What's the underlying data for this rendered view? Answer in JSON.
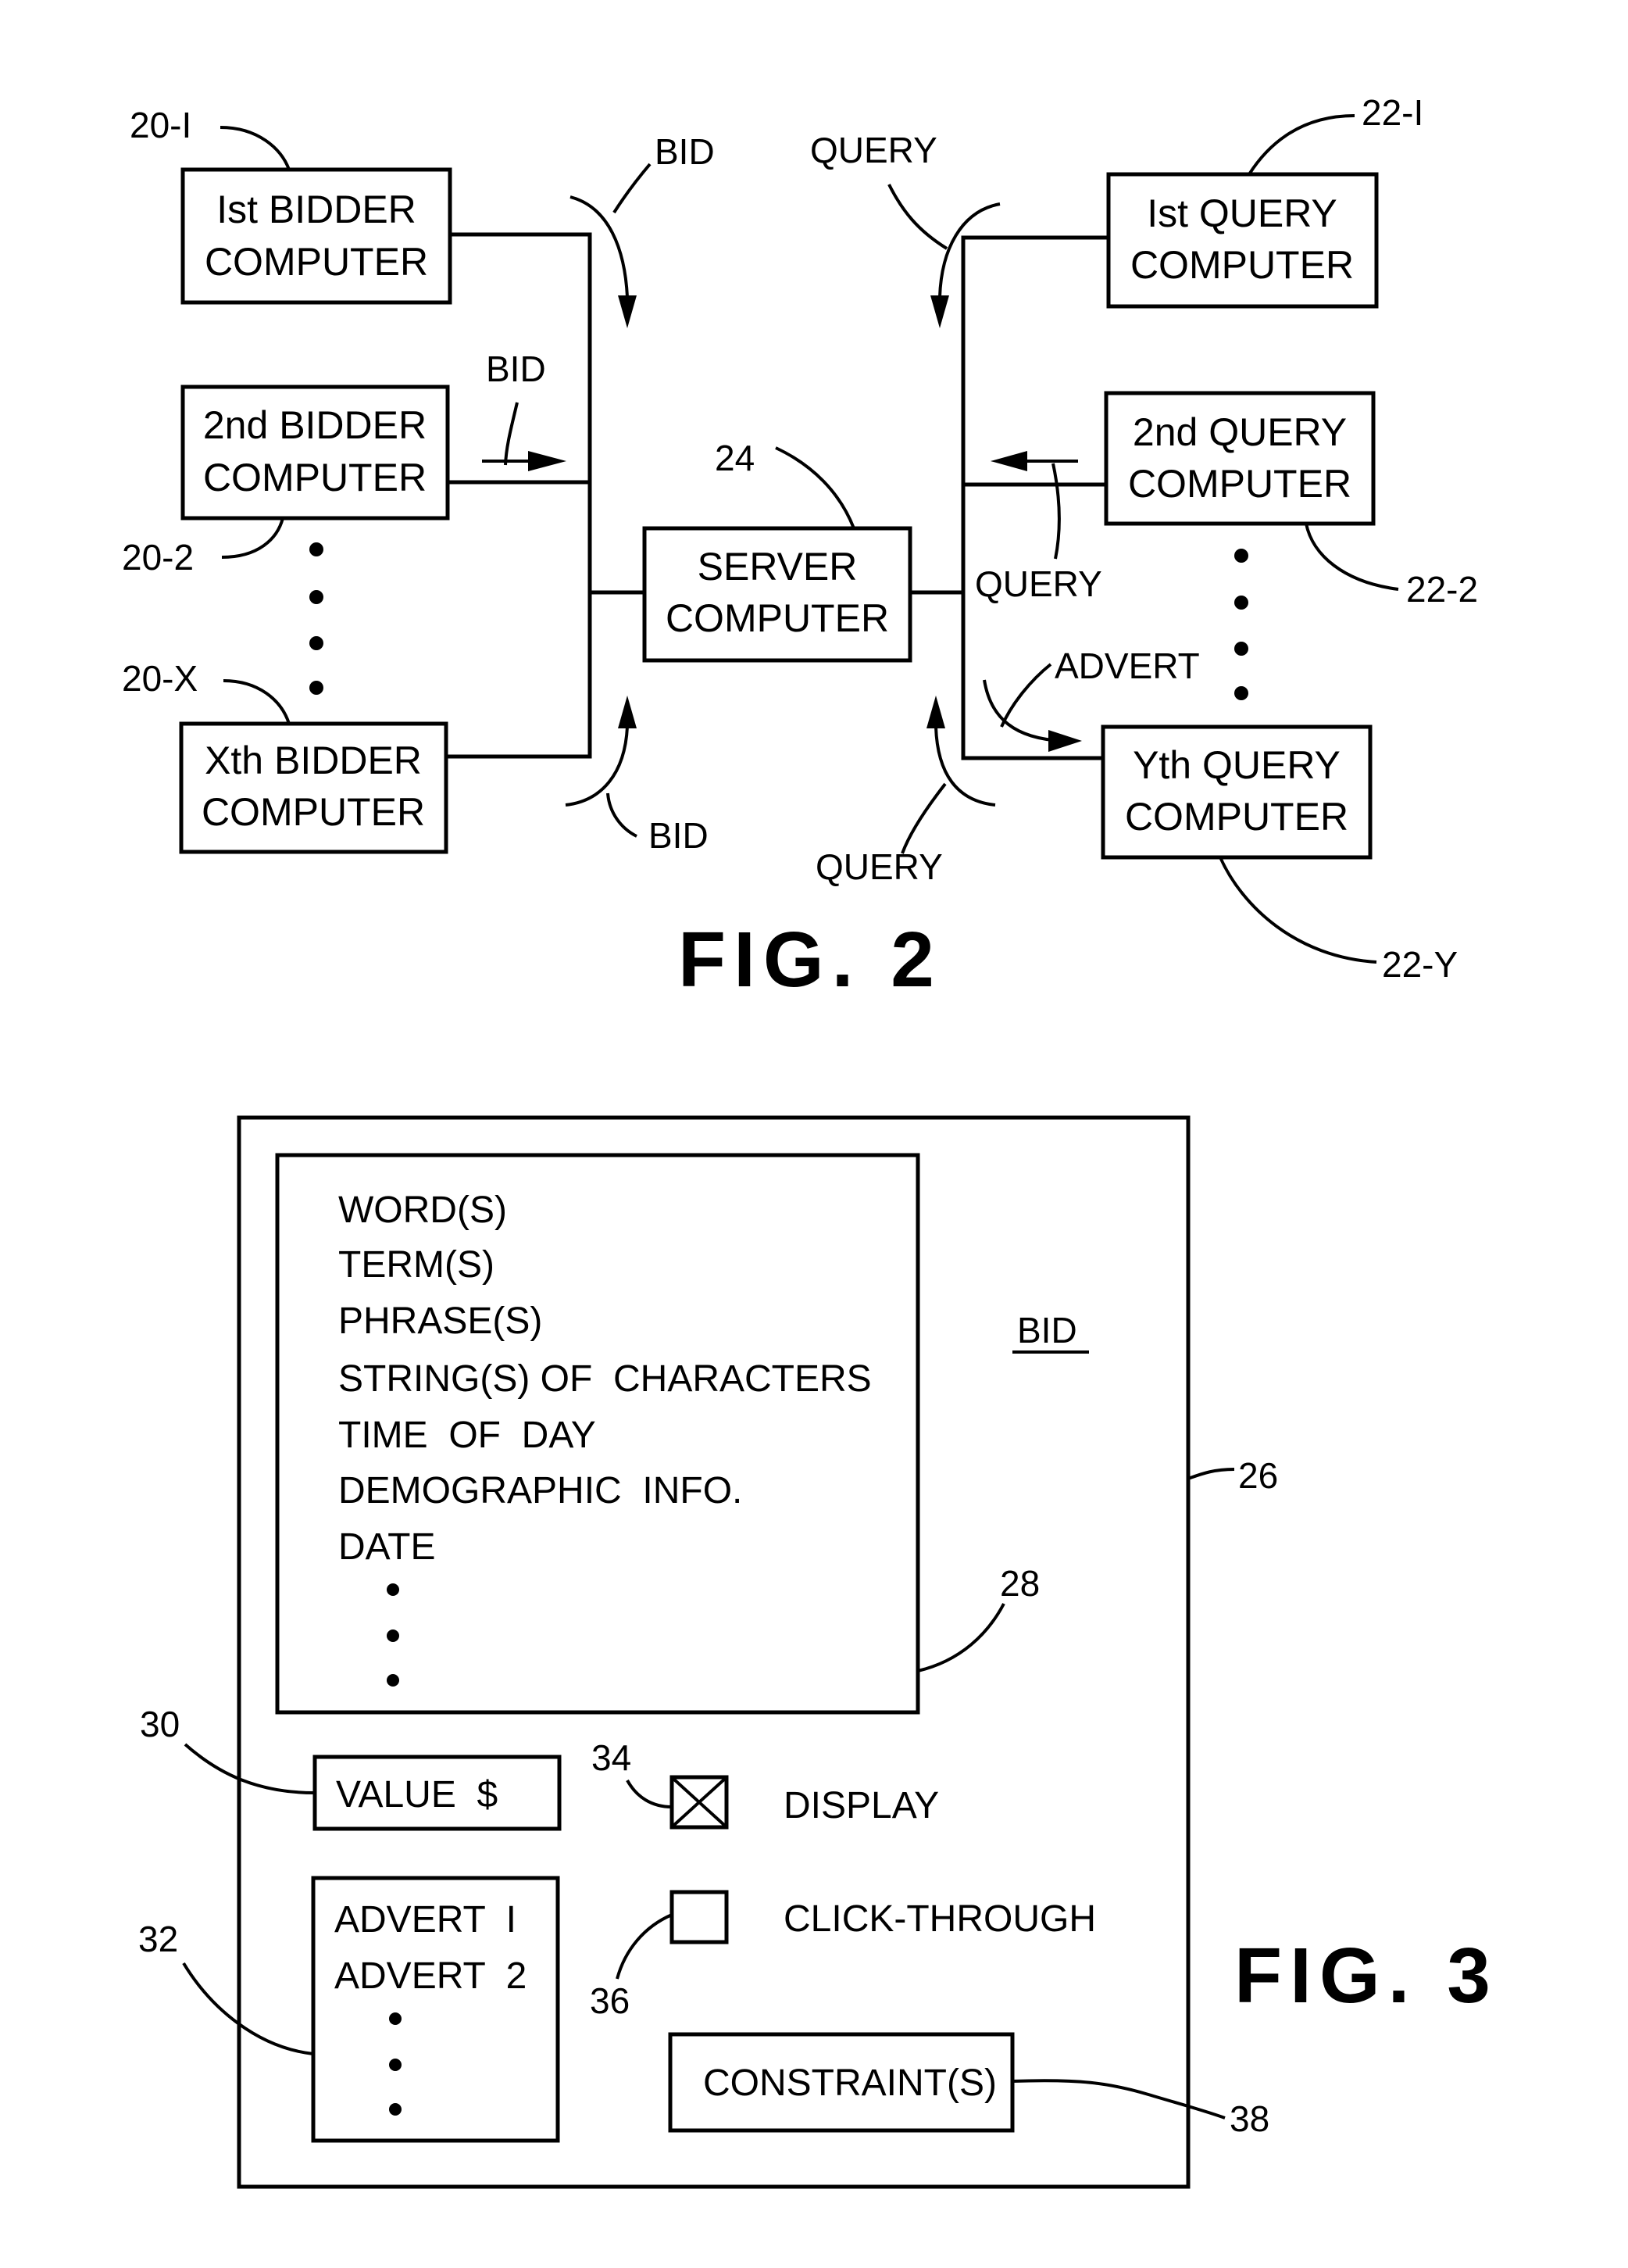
{
  "fig2": {
    "title": "FIG. 2",
    "bidders": [
      {
        "line1": "Ist BIDDER",
        "line2": "COMPUTER",
        "ref": "20-I"
      },
      {
        "line1": "2nd BIDDER",
        "line2": "COMPUTER",
        "ref": "20-2"
      },
      {
        "line1": "Xth BIDDER",
        "line2": "COMPUTER",
        "ref": "20-X"
      }
    ],
    "server": {
      "line1": "SERVER",
      "line2": "COMPUTER",
      "ref": "24"
    },
    "queries": [
      {
        "line1": "Ist QUERY",
        "line2": "COMPUTER",
        "ref": "22-I"
      },
      {
        "line1": "2nd QUERY",
        "line2": "COMPUTER",
        "ref": "22-2"
      },
      {
        "line1": "Yth QUERY",
        "line2": "COMPUTER",
        "ref": "22-Y"
      }
    ],
    "flow_labels": {
      "bid_top": "BID",
      "bid_middle": "BID",
      "bid_bottom": "BID",
      "query_top": "QUERY",
      "query_middle": "QUERY",
      "query_bottom": "QUERY",
      "advert": "ADVERT"
    }
  },
  "fig3": {
    "title": "FIG. 3",
    "bid_label": "BID",
    "outer_ref": "26",
    "criteria_ref": "28",
    "criteria": [
      "WORD(S)",
      "TERM(S)",
      "PHRASE(S)",
      "STRING(S) OF  CHARACTERS",
      "TIME  OF  DAY",
      "DEMOGRAPHIC  INFO.",
      "DATE"
    ],
    "value": {
      "label": "VALUE  $",
      "ref": "30"
    },
    "adverts": {
      "items": [
        "ADVERT  I",
        "ADVERT  2"
      ],
      "ref": "32"
    },
    "display": {
      "label": "DISPLAY",
      "checked": true,
      "ref": "34"
    },
    "click_through": {
      "label": "CLICK-THROUGH",
      "checked": false,
      "ref": "36"
    },
    "constraints": {
      "label": "CONSTRAINT(S)",
      "ref": "38"
    }
  }
}
